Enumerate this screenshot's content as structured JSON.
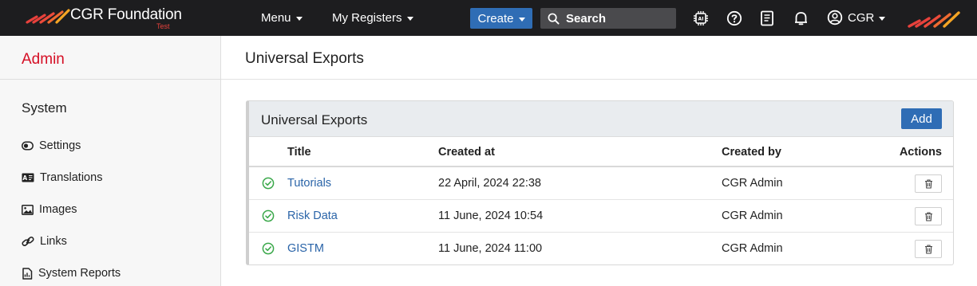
{
  "topbar": {
    "brand": "CGR Foundation",
    "brand_sub": "Test",
    "menu_label": "Menu",
    "registers_label": "My Registers",
    "create_label": "Create",
    "search_placeholder": "Search",
    "user_label": "CGR",
    "icons": [
      "ai-chip-icon",
      "help-icon",
      "book-icon",
      "bell-icon",
      "user-icon"
    ],
    "colors": {
      "bar": "#1d1d1f",
      "create": "#2f6db5",
      "logo_red": "#e8413c",
      "logo_orange": "#f5a524"
    }
  },
  "sidebar": {
    "title": "Admin",
    "section": "System",
    "items": [
      {
        "label": "Settings",
        "icon": "toggle-icon"
      },
      {
        "label": "Translations",
        "icon": "translation-icon"
      },
      {
        "label": "Images",
        "icon": "image-icon"
      },
      {
        "label": "Links",
        "icon": "link-icon"
      },
      {
        "label": "System Reports",
        "icon": "report-icon"
      }
    ]
  },
  "main": {
    "page_title": "Universal Exports",
    "panel_title": "Universal Exports",
    "add_label": "Add",
    "columns": {
      "title": "Title",
      "created_at": "Created at",
      "created_by": "Created by",
      "actions": "Actions"
    },
    "rows": [
      {
        "title": "Tutorials",
        "created_at": "22 April, 2024 22:38",
        "created_by": "CGR Admin",
        "status": "complete"
      },
      {
        "title": "Risk Data",
        "created_at": "11 June, 2024 10:54",
        "created_by": "CGR Admin",
        "status": "complete"
      },
      {
        "title": "GISTM",
        "created_at": "11 June, 2024 11:00",
        "created_by": "CGR Admin",
        "status": "complete"
      }
    ],
    "colors": {
      "link": "#2a64a8",
      "status_ok": "#3aa84a",
      "accent": "#d50f25"
    }
  }
}
